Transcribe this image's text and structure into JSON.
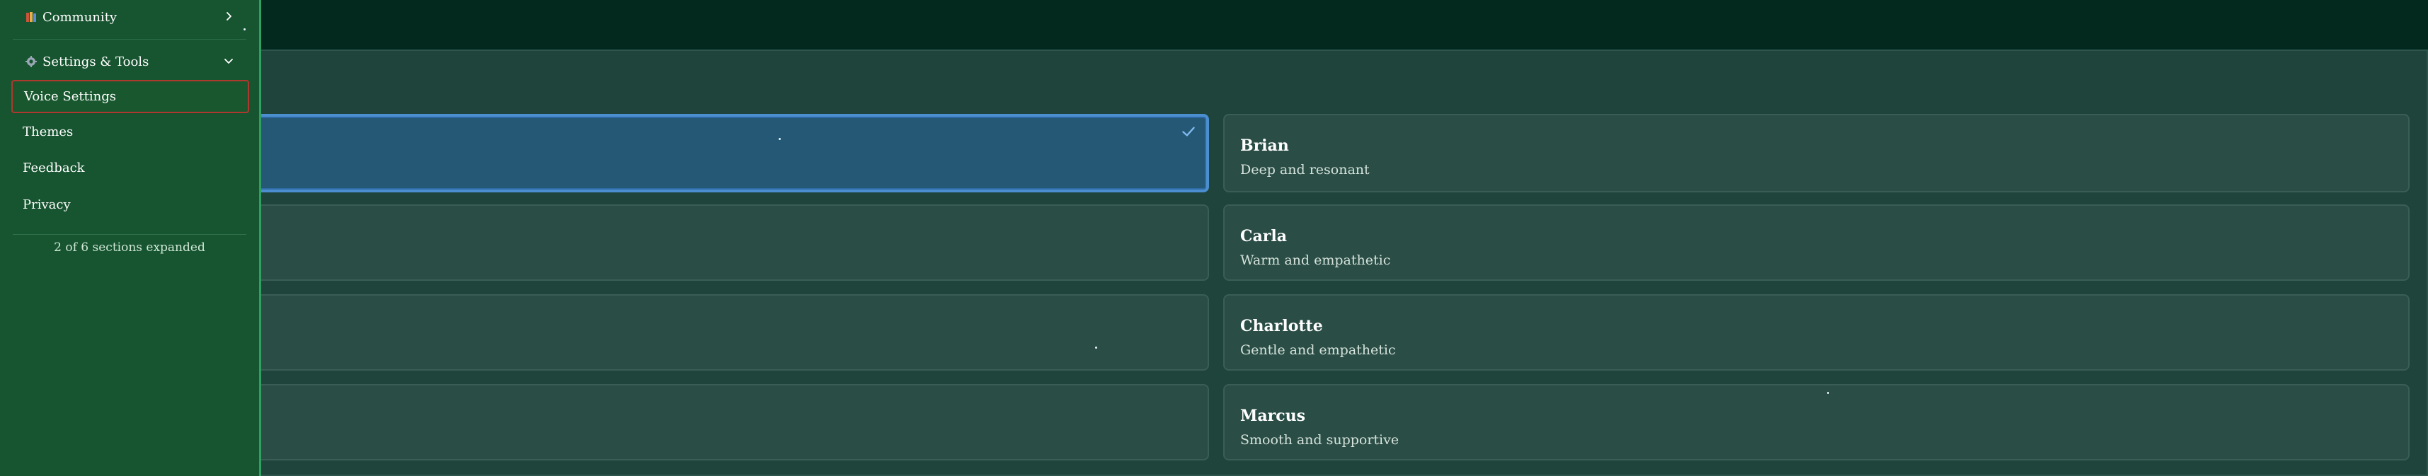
{
  "sidebar": {
    "sections": [
      {
        "label": "Community",
        "icon": "books-icon",
        "expanded": false
      },
      {
        "label": "Settings & Tools",
        "icon": "gear-icon",
        "expanded": true
      }
    ],
    "items": [
      {
        "label": "Voice Settings",
        "active": true
      },
      {
        "label": "Themes",
        "active": false
      },
      {
        "label": "Feedback",
        "active": false
      },
      {
        "label": "Privacy",
        "active": false
      }
    ],
    "footer": "2 of 6 sections expanded"
  },
  "voices": [
    {
      "name": "",
      "description": "",
      "selected": true
    },
    {
      "name": "Brian",
      "description": "Deep and resonant",
      "selected": false
    },
    {
      "name": "",
      "description": "",
      "selected": false
    },
    {
      "name": "Carla",
      "description": "Warm and empathetic",
      "selected": false
    },
    {
      "name": "",
      "description": "",
      "selected": false
    },
    {
      "name": "Charlotte",
      "description": "Gentle and empathetic",
      "selected": false
    },
    {
      "name": "",
      "description": "",
      "selected": false
    },
    {
      "name": "Marcus",
      "description": "Smooth and supportive",
      "selected": false
    }
  ],
  "colors": {
    "background": "#03291f",
    "panel": "#1f443b",
    "card": "#2a4d45",
    "card_selected": "#245874",
    "selected_border": "#4c8fd1",
    "sidebar": "#175430",
    "active_item_border": "#b0382e"
  }
}
